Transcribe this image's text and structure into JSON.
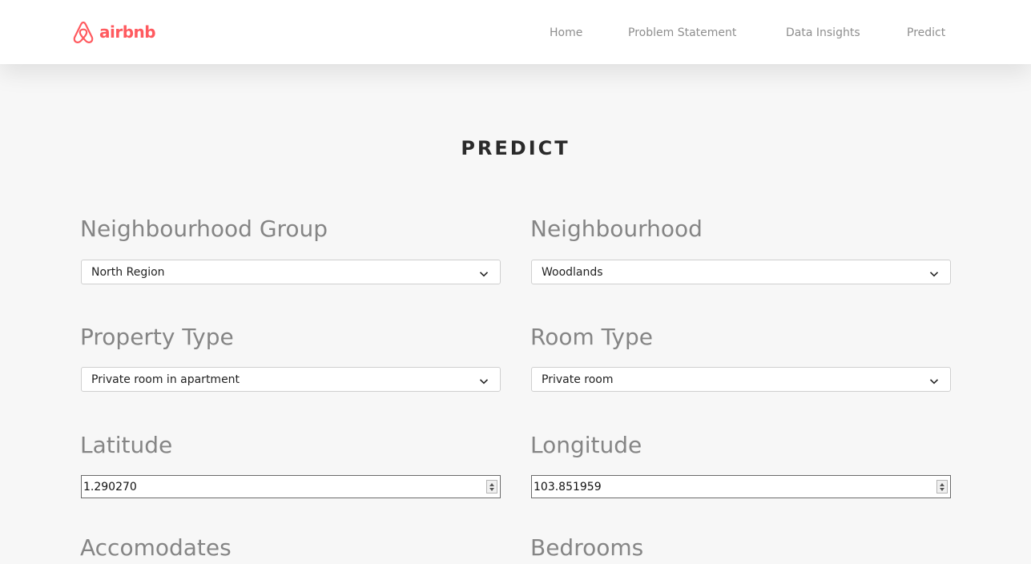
{
  "brand": {
    "name": "airbnb",
    "color": "#ff5a5f",
    "icon": "airbnb-logo-icon"
  },
  "nav": {
    "home": "Home",
    "problem": "Problem Statement",
    "insights": "Data Insights",
    "predict": "Predict"
  },
  "page": {
    "title": "PREDICT"
  },
  "form": {
    "neighbourhood_group": {
      "label": "Neighbourhood Group",
      "value": "North Region"
    },
    "neighbourhood": {
      "label": "Neighbourhood",
      "value": "Woodlands"
    },
    "property_type": {
      "label": "Property Type",
      "value": "Private room in apartment"
    },
    "room_type": {
      "label": "Room Type",
      "value": "Private room"
    },
    "latitude": {
      "label": "Latitude",
      "value": "1.290270"
    },
    "longitude": {
      "label": "Longitude",
      "value": "103.851959"
    },
    "accomodates": {
      "label": "Accomodates"
    },
    "bedrooms": {
      "label": "Bedrooms"
    }
  }
}
